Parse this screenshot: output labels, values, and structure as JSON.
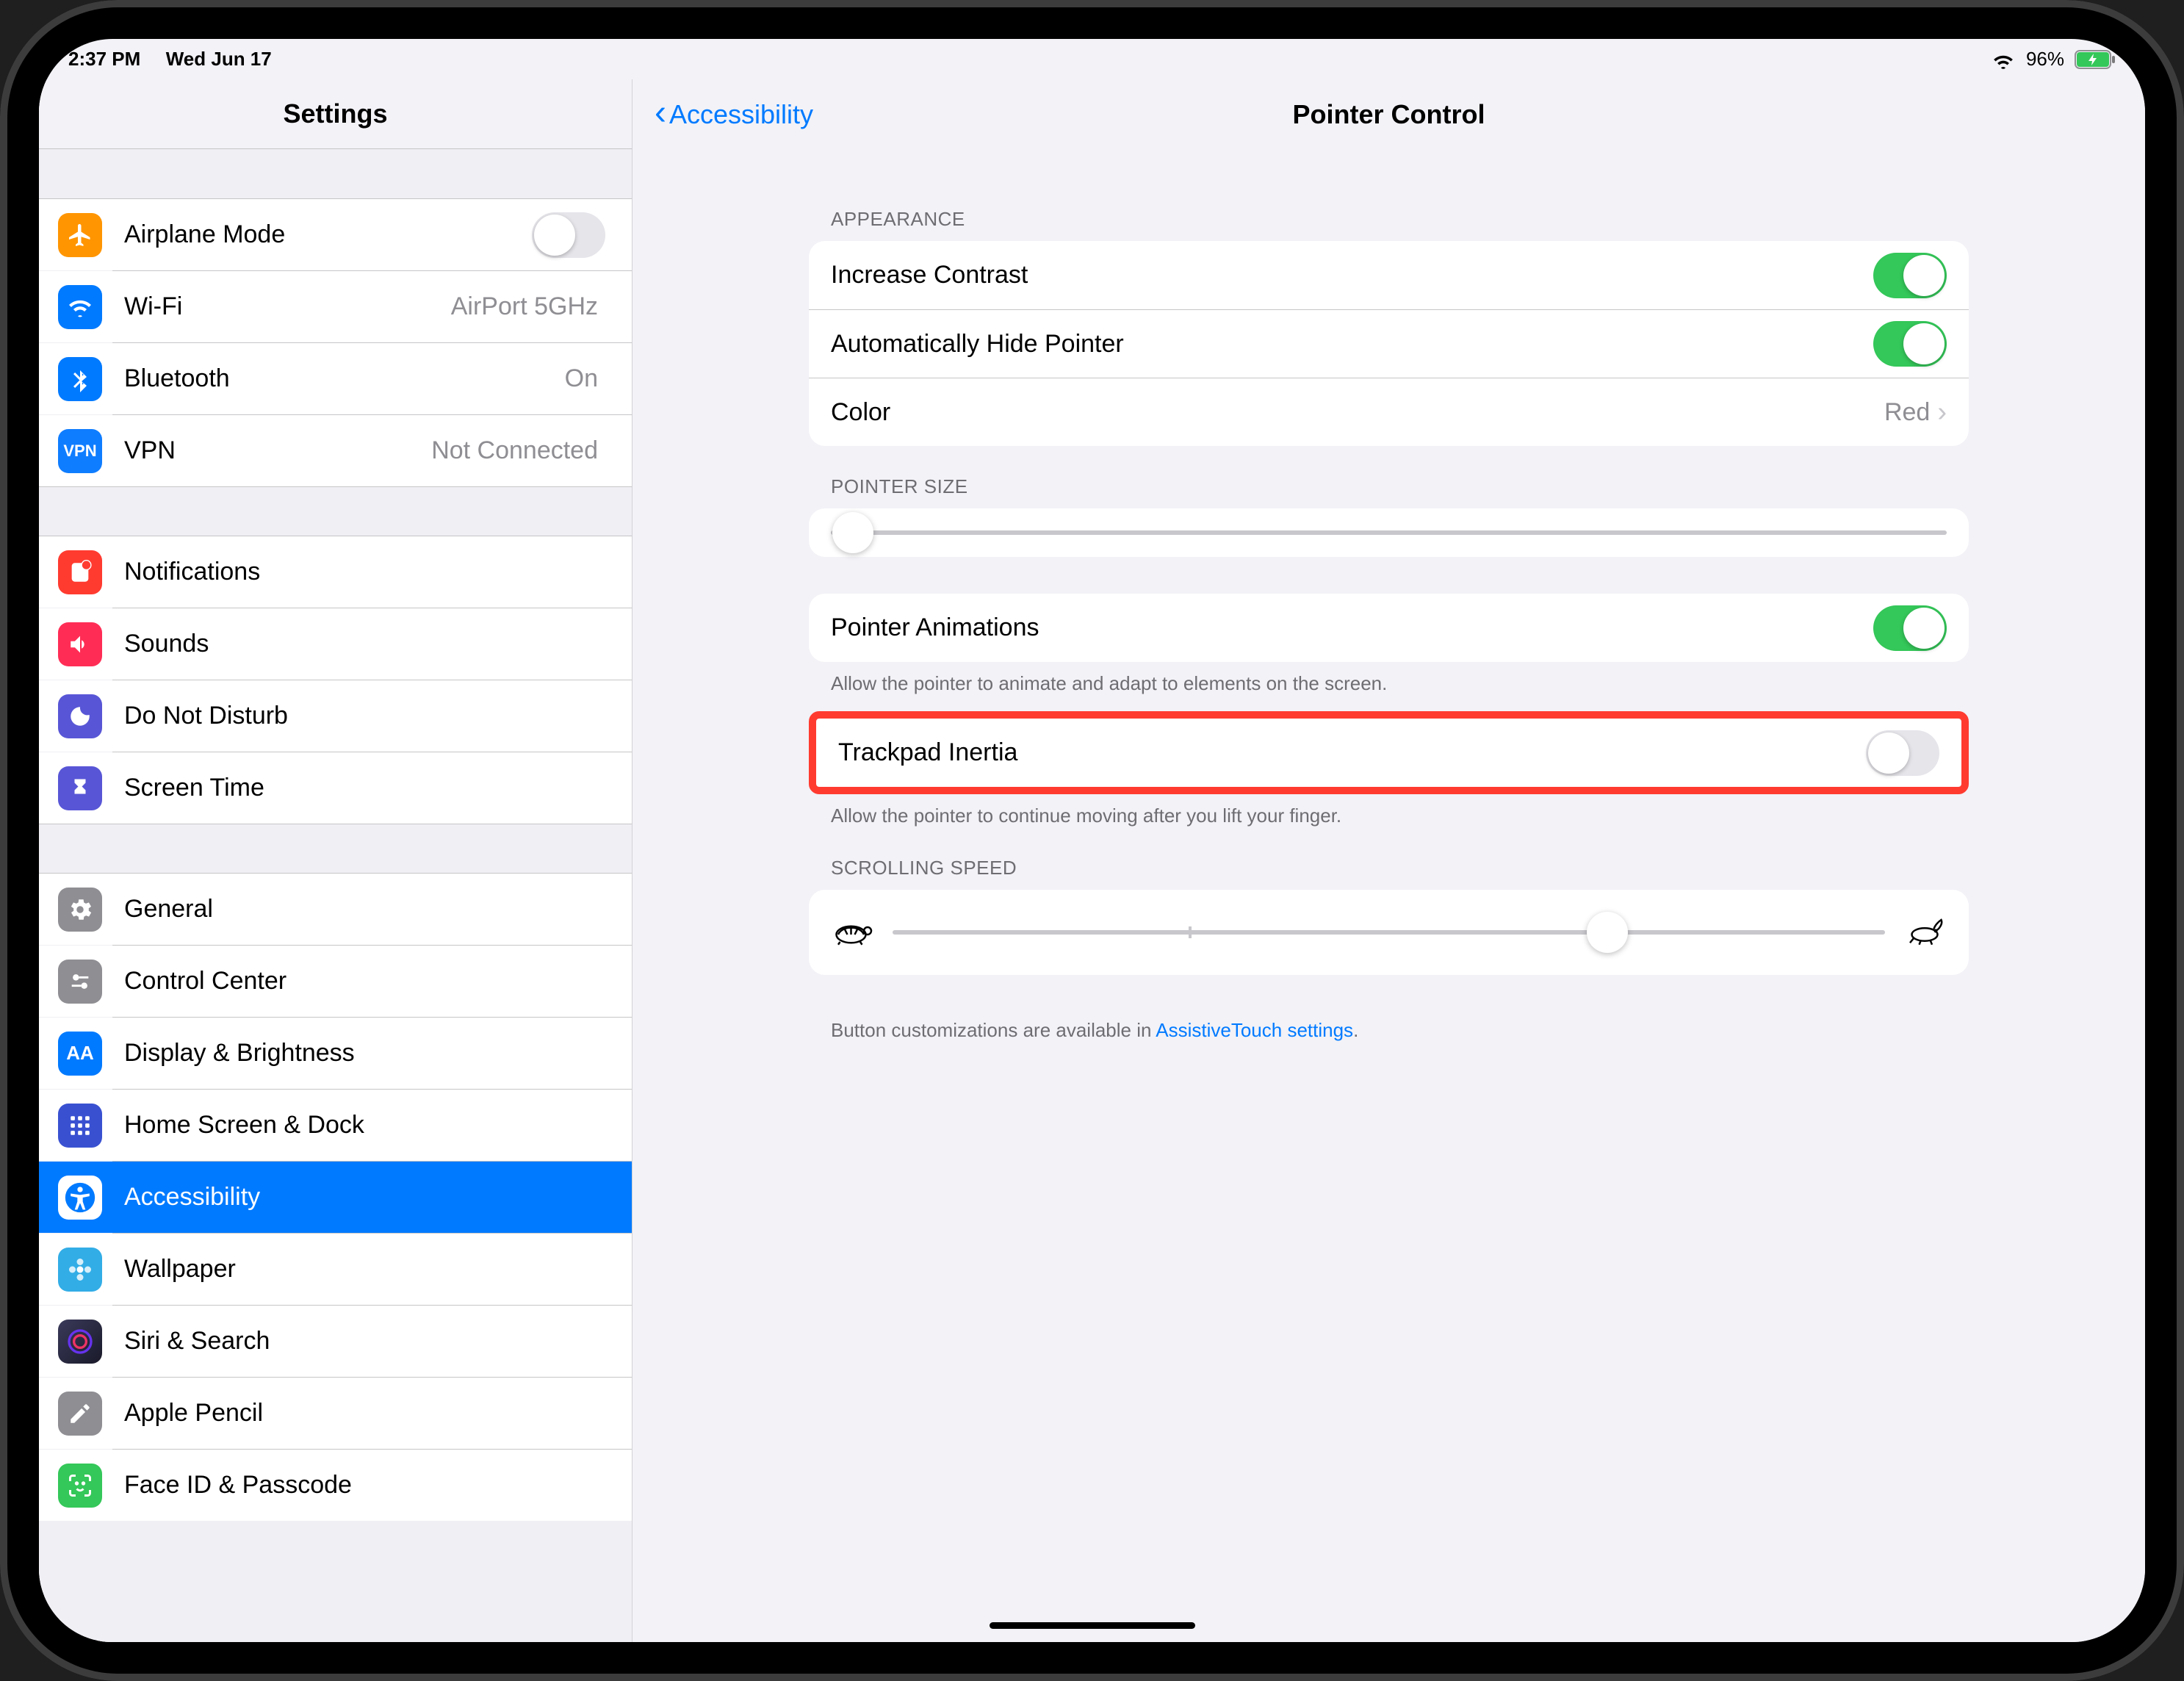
{
  "status": {
    "time": "2:37 PM",
    "date": "Wed Jun 17",
    "battery": "96%"
  },
  "sidebar": {
    "title": "Settings",
    "airplane": {
      "label": "Airplane Mode"
    },
    "wifi": {
      "label": "Wi-Fi",
      "value": "AirPort 5GHz"
    },
    "bluetooth": {
      "label": "Bluetooth",
      "value": "On"
    },
    "vpn": {
      "label": "VPN",
      "value": "Not Connected"
    },
    "notifications": {
      "label": "Notifications"
    },
    "sounds": {
      "label": "Sounds"
    },
    "dnd": {
      "label": "Do Not Disturb"
    },
    "screentime": {
      "label": "Screen Time"
    },
    "general": {
      "label": "General"
    },
    "controlcenter": {
      "label": "Control Center"
    },
    "display": {
      "label": "Display & Brightness"
    },
    "homescreen": {
      "label": "Home Screen & Dock"
    },
    "accessibility": {
      "label": "Accessibility"
    },
    "wallpaper": {
      "label": "Wallpaper"
    },
    "siri": {
      "label": "Siri & Search"
    },
    "pencil": {
      "label": "Apple Pencil"
    },
    "faceid": {
      "label": "Face ID & Passcode"
    }
  },
  "detail": {
    "back": "Accessibility",
    "title": "Pointer Control",
    "appearance_header": "APPEARANCE",
    "increase_contrast": "Increase Contrast",
    "auto_hide": "Automatically Hide Pointer",
    "color_label": "Color",
    "color_value": "Red",
    "pointer_size_header": "POINTER SIZE",
    "pointer_animations": "Pointer Animations",
    "pointer_animations_footer": "Allow the pointer to animate and adapt to elements on the screen.",
    "trackpad_inertia": "Trackpad Inertia",
    "trackpad_inertia_footer": "Allow the pointer to continue moving after you lift your finger.",
    "scrolling_speed_header": "SCROLLING SPEED",
    "footer_prefix": "Button customizations are available in ",
    "footer_link": "AssistiveTouch settings",
    "footer_suffix": ".",
    "toggles": {
      "increase_contrast": true,
      "auto_hide": true,
      "pointer_animations": true,
      "trackpad_inertia": false
    },
    "pointer_size_value": 0.02,
    "scrolling_speed_value": 0.7
  }
}
